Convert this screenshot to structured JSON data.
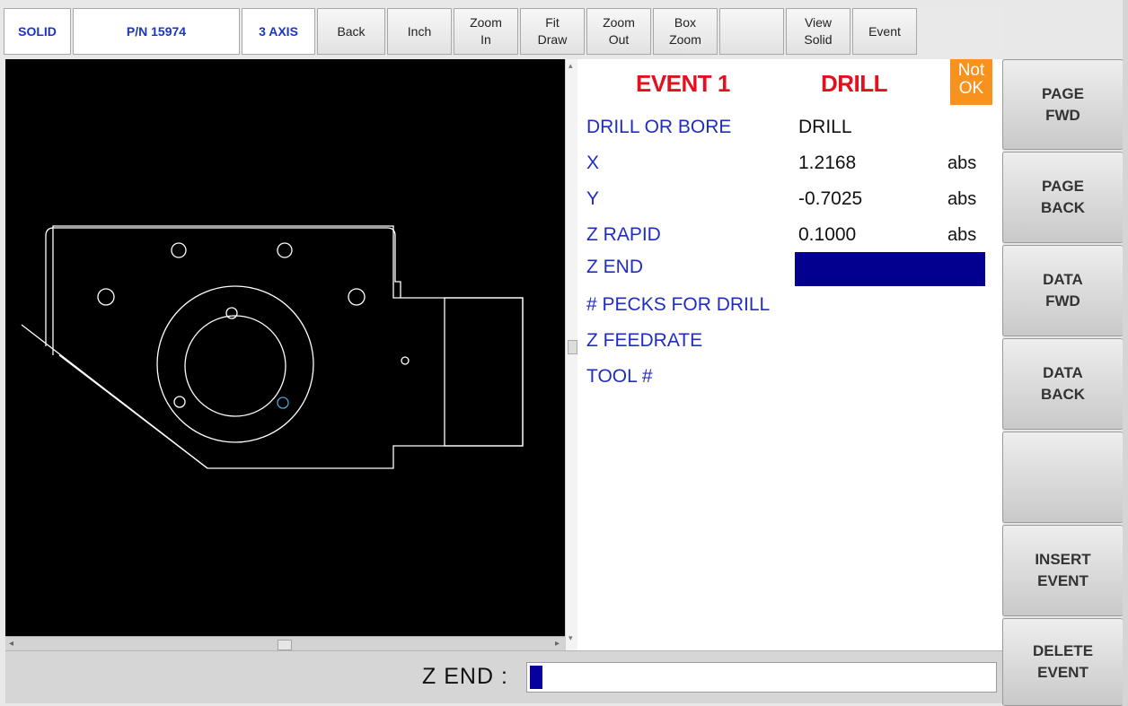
{
  "toolbar": {
    "solid": "SOLID",
    "part_number": "P/N 15974",
    "axis_mode": "3 AXIS",
    "back": "Back",
    "units": "Inch",
    "zoom_in": "Zoom\nIn",
    "fit_draw": "Fit\nDraw",
    "zoom_out": "Zoom\nOut",
    "box_zoom": "Box\nZoom",
    "view_solid": "View\nSolid",
    "event": "Event"
  },
  "panel": {
    "event_title": "EVENT 1",
    "event_type": "DRILL",
    "status": "Not\nOK",
    "fields": [
      {
        "label": "DRILL OR  BORE",
        "value": "DRILL",
        "unit": ""
      },
      {
        "label": "X",
        "value": "1.2168",
        "unit": "abs"
      },
      {
        "label": "Y",
        "value": "-0.7025",
        "unit": "abs"
      },
      {
        "label": "Z RAPID",
        "value": "0.1000",
        "unit": "abs"
      },
      {
        "label": "Z END",
        "value": "",
        "unit": ""
      },
      {
        "label": "# PECKS FOR DRILL",
        "value": "",
        "unit": ""
      },
      {
        "label": "Z FEEDRATE",
        "value": "",
        "unit": ""
      },
      {
        "label": "TOOL #",
        "value": "",
        "unit": ""
      }
    ],
    "active_field_color": "#04008f"
  },
  "side_buttons": {
    "page_fwd": "PAGE\nFWD",
    "page_back": "PAGE\nBACK",
    "data_fwd": "DATA\nFWD",
    "data_back": "DATA\nBACK",
    "blank": "",
    "insert_event": "INSERT\nEVENT",
    "delete_event": "DELETE\nEVENT"
  },
  "prompt": {
    "label": "Z END :",
    "value": ""
  },
  "colors": {
    "label_blue": "#1f2dc2",
    "title_red": "#e3101e",
    "status_orange": "#f7921e",
    "viewport_bg": "#000000",
    "drawing_line": "#ffffff",
    "selected_hole": "#4aa3d8"
  }
}
